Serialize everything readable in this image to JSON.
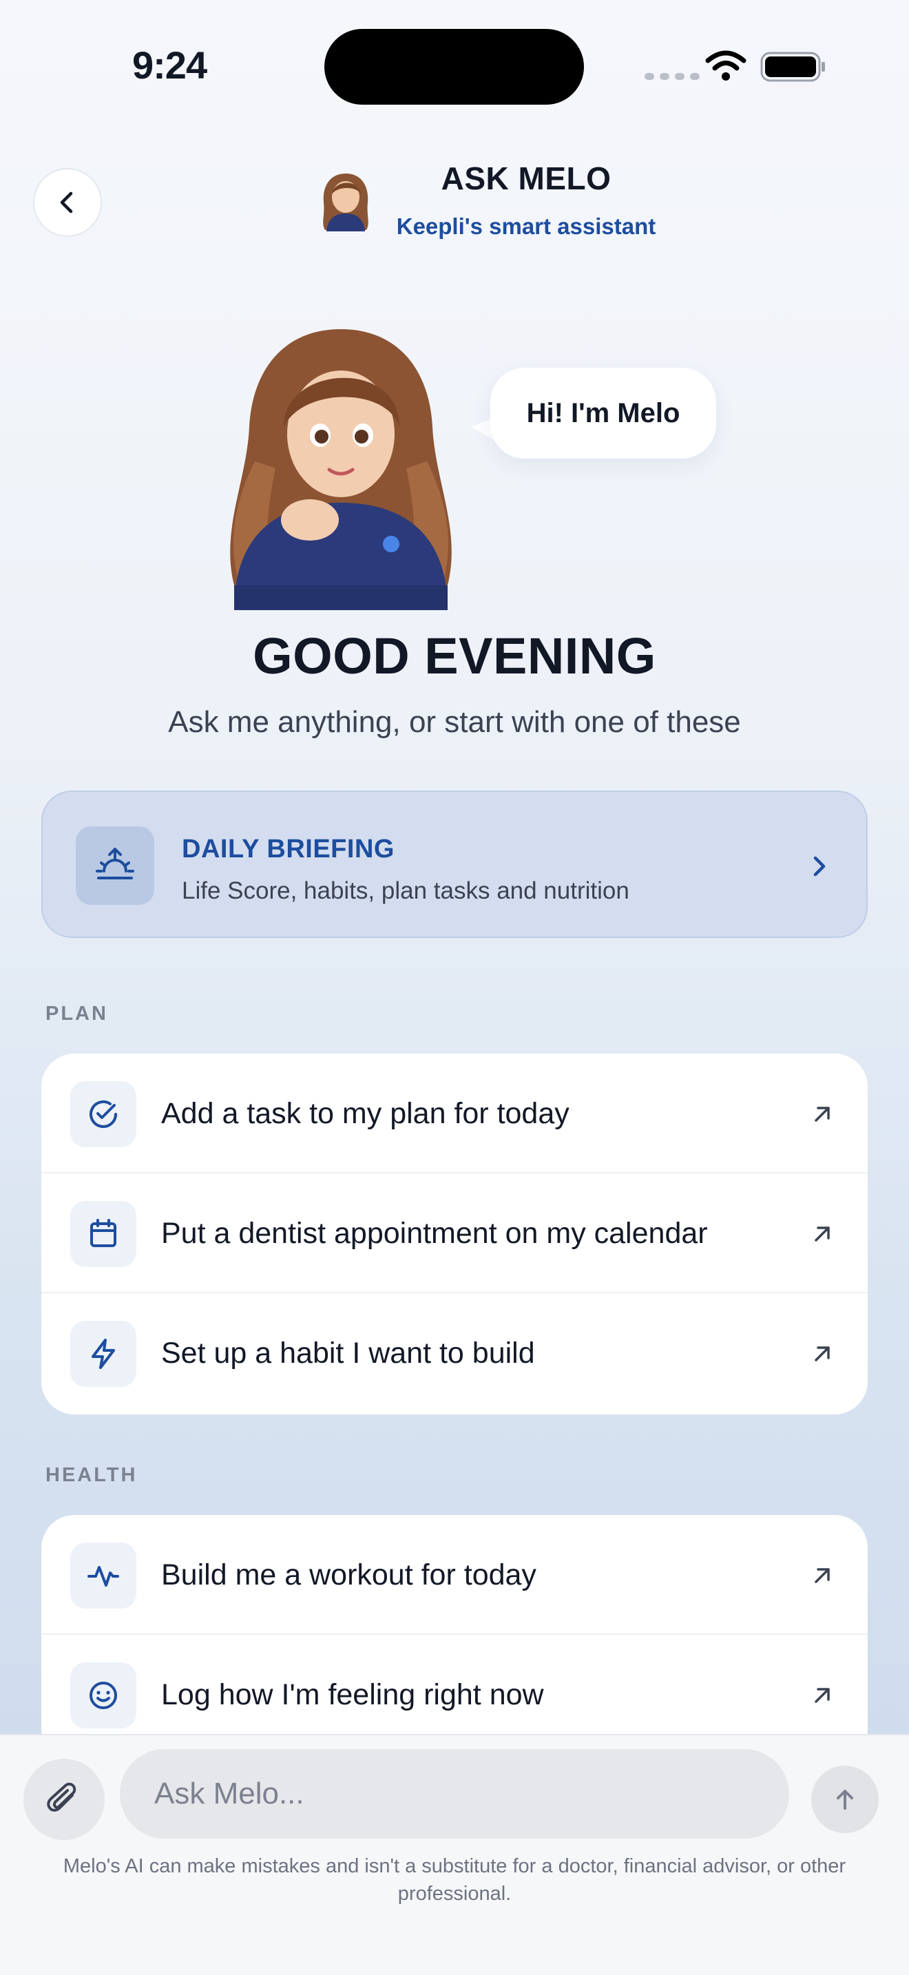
{
  "status_bar": {
    "time": "9:24"
  },
  "header": {
    "title": "ASK MELO",
    "subtitle": "Keepli's smart assistant",
    "back_icon": "chevron-left-icon"
  },
  "hero": {
    "bubble_text": "Hi! I'm Melo",
    "greeting": "GOOD EVENING",
    "prompt": "Ask me anything, or start with one of these"
  },
  "briefing": {
    "title": "DAILY BRIEFING",
    "subtitle": "Life Score, habits, plan tasks and nutrition",
    "icon": "sunrise-icon"
  },
  "sections": {
    "plan": {
      "label": "PLAN",
      "items": [
        {
          "label": "Add a task to my plan for today",
          "icon": "check-circle-icon"
        },
        {
          "label": "Put a dentist appointment on my calendar",
          "icon": "calendar-icon"
        },
        {
          "label": "Set up a habit I want to build",
          "icon": "lightning-icon"
        }
      ]
    },
    "health": {
      "label": "HEALTH",
      "items": [
        {
          "label": "Build me a workout for today",
          "icon": "activity-icon"
        },
        {
          "label": "Log how I'm feeling right now",
          "icon": "smile-icon"
        }
      ]
    }
  },
  "composer": {
    "placeholder": "Ask Melo...",
    "disclaimer": "Melo's AI can make mistakes and isn't a substitute for a doctor, financial advisor, or other professional."
  },
  "colors": {
    "accent": "#1d4d9e",
    "briefing_bg": "#d3ddef",
    "card_bg": "#ffffff"
  }
}
